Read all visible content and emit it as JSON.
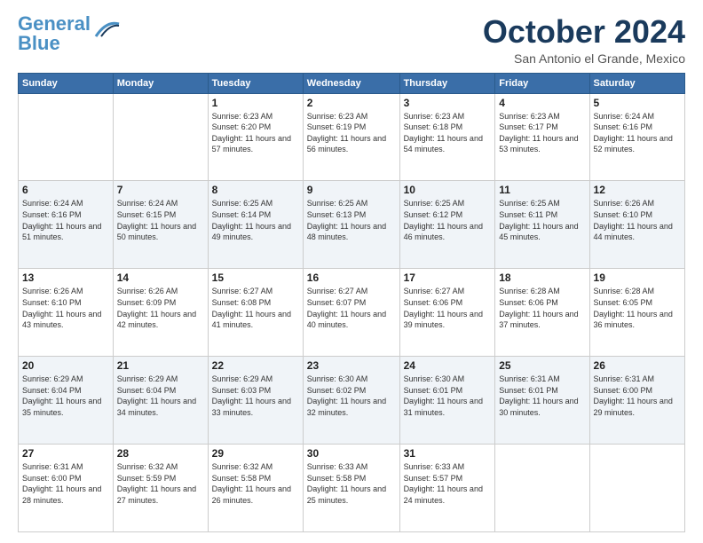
{
  "logo": {
    "line1": "General",
    "line2": "Blue"
  },
  "title": "October 2024",
  "location": "San Antonio el Grande, Mexico",
  "days_header": [
    "Sunday",
    "Monday",
    "Tuesday",
    "Wednesday",
    "Thursday",
    "Friday",
    "Saturday"
  ],
  "weeks": [
    [
      {
        "num": "",
        "info": ""
      },
      {
        "num": "",
        "info": ""
      },
      {
        "num": "1",
        "info": "Sunrise: 6:23 AM\nSunset: 6:20 PM\nDaylight: 11 hours and 57 minutes."
      },
      {
        "num": "2",
        "info": "Sunrise: 6:23 AM\nSunset: 6:19 PM\nDaylight: 11 hours and 56 minutes."
      },
      {
        "num": "3",
        "info": "Sunrise: 6:23 AM\nSunset: 6:18 PM\nDaylight: 11 hours and 54 minutes."
      },
      {
        "num": "4",
        "info": "Sunrise: 6:23 AM\nSunset: 6:17 PM\nDaylight: 11 hours and 53 minutes."
      },
      {
        "num": "5",
        "info": "Sunrise: 6:24 AM\nSunset: 6:16 PM\nDaylight: 11 hours and 52 minutes."
      }
    ],
    [
      {
        "num": "6",
        "info": "Sunrise: 6:24 AM\nSunset: 6:16 PM\nDaylight: 11 hours and 51 minutes."
      },
      {
        "num": "7",
        "info": "Sunrise: 6:24 AM\nSunset: 6:15 PM\nDaylight: 11 hours and 50 minutes."
      },
      {
        "num": "8",
        "info": "Sunrise: 6:25 AM\nSunset: 6:14 PM\nDaylight: 11 hours and 49 minutes."
      },
      {
        "num": "9",
        "info": "Sunrise: 6:25 AM\nSunset: 6:13 PM\nDaylight: 11 hours and 48 minutes."
      },
      {
        "num": "10",
        "info": "Sunrise: 6:25 AM\nSunset: 6:12 PM\nDaylight: 11 hours and 46 minutes."
      },
      {
        "num": "11",
        "info": "Sunrise: 6:25 AM\nSunset: 6:11 PM\nDaylight: 11 hours and 45 minutes."
      },
      {
        "num": "12",
        "info": "Sunrise: 6:26 AM\nSunset: 6:10 PM\nDaylight: 11 hours and 44 minutes."
      }
    ],
    [
      {
        "num": "13",
        "info": "Sunrise: 6:26 AM\nSunset: 6:10 PM\nDaylight: 11 hours and 43 minutes."
      },
      {
        "num": "14",
        "info": "Sunrise: 6:26 AM\nSunset: 6:09 PM\nDaylight: 11 hours and 42 minutes."
      },
      {
        "num": "15",
        "info": "Sunrise: 6:27 AM\nSunset: 6:08 PM\nDaylight: 11 hours and 41 minutes."
      },
      {
        "num": "16",
        "info": "Sunrise: 6:27 AM\nSunset: 6:07 PM\nDaylight: 11 hours and 40 minutes."
      },
      {
        "num": "17",
        "info": "Sunrise: 6:27 AM\nSunset: 6:06 PM\nDaylight: 11 hours and 39 minutes."
      },
      {
        "num": "18",
        "info": "Sunrise: 6:28 AM\nSunset: 6:06 PM\nDaylight: 11 hours and 37 minutes."
      },
      {
        "num": "19",
        "info": "Sunrise: 6:28 AM\nSunset: 6:05 PM\nDaylight: 11 hours and 36 minutes."
      }
    ],
    [
      {
        "num": "20",
        "info": "Sunrise: 6:29 AM\nSunset: 6:04 PM\nDaylight: 11 hours and 35 minutes."
      },
      {
        "num": "21",
        "info": "Sunrise: 6:29 AM\nSunset: 6:04 PM\nDaylight: 11 hours and 34 minutes."
      },
      {
        "num": "22",
        "info": "Sunrise: 6:29 AM\nSunset: 6:03 PM\nDaylight: 11 hours and 33 minutes."
      },
      {
        "num": "23",
        "info": "Sunrise: 6:30 AM\nSunset: 6:02 PM\nDaylight: 11 hours and 32 minutes."
      },
      {
        "num": "24",
        "info": "Sunrise: 6:30 AM\nSunset: 6:01 PM\nDaylight: 11 hours and 31 minutes."
      },
      {
        "num": "25",
        "info": "Sunrise: 6:31 AM\nSunset: 6:01 PM\nDaylight: 11 hours and 30 minutes."
      },
      {
        "num": "26",
        "info": "Sunrise: 6:31 AM\nSunset: 6:00 PM\nDaylight: 11 hours and 29 minutes."
      }
    ],
    [
      {
        "num": "27",
        "info": "Sunrise: 6:31 AM\nSunset: 6:00 PM\nDaylight: 11 hours and 28 minutes."
      },
      {
        "num": "28",
        "info": "Sunrise: 6:32 AM\nSunset: 5:59 PM\nDaylight: 11 hours and 27 minutes."
      },
      {
        "num": "29",
        "info": "Sunrise: 6:32 AM\nSunset: 5:58 PM\nDaylight: 11 hours and 26 minutes."
      },
      {
        "num": "30",
        "info": "Sunrise: 6:33 AM\nSunset: 5:58 PM\nDaylight: 11 hours and 25 minutes."
      },
      {
        "num": "31",
        "info": "Sunrise: 6:33 AM\nSunset: 5:57 PM\nDaylight: 11 hours and 24 minutes."
      },
      {
        "num": "",
        "info": ""
      },
      {
        "num": "",
        "info": ""
      }
    ]
  ]
}
